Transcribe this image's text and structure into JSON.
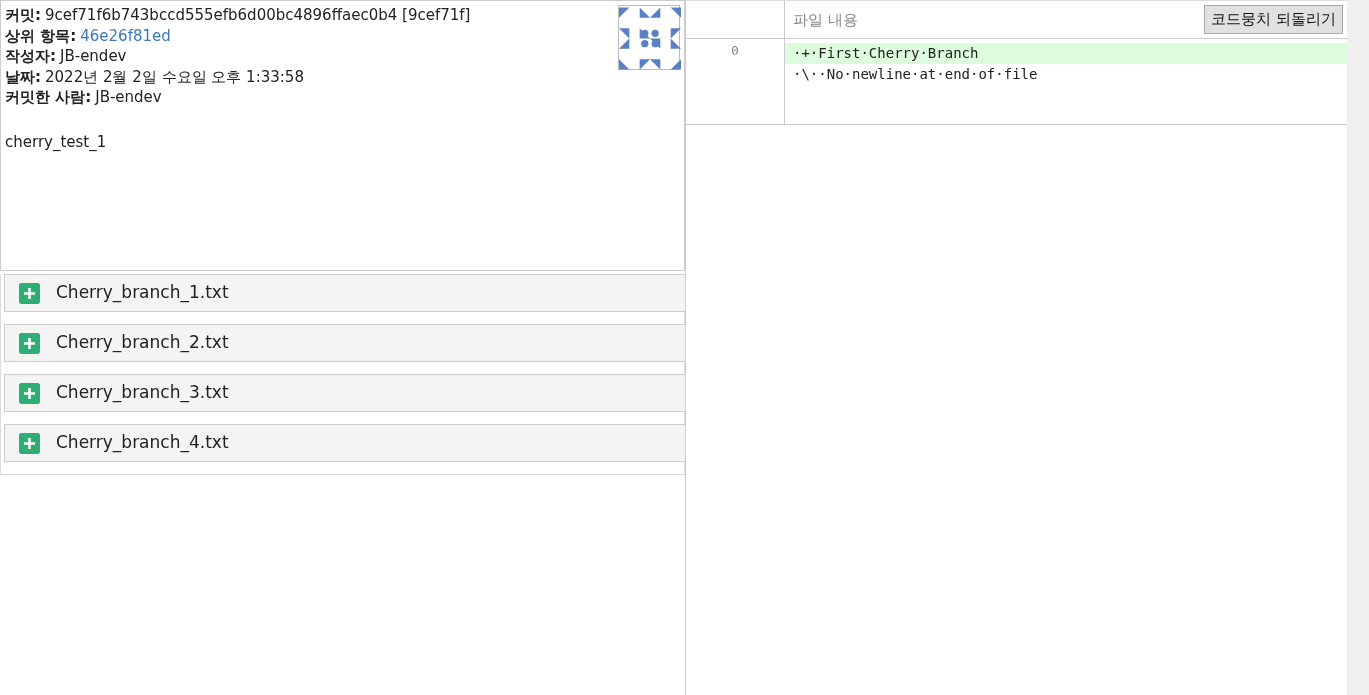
{
  "commit_info": {
    "fields": [
      {
        "label": "커밋:",
        "value": "9cef71f6b743bccd555efb6d00bc4896ffaec0b4 [9cef71f]",
        "kind": "text"
      },
      {
        "label": "상위 항목:",
        "value": "46e26f81ed",
        "kind": "link"
      },
      {
        "label": "작성자:",
        "value": "JB-endev",
        "kind": "text"
      },
      {
        "label": "날짜:",
        "value": "2022년 2월 2일 수요일 오후 1:33:58",
        "kind": "text"
      },
      {
        "label": "커밋한 사람:",
        "value": "JB-endev",
        "kind": "text"
      }
    ],
    "message": "cherry_test_1"
  },
  "files": [
    {
      "name": "Cherry_branch_1.txt",
      "kind": "added"
    },
    {
      "name": "Cherry_branch_2.txt",
      "kind": "added"
    },
    {
      "name": "Cherry_branch_3.txt",
      "kind": "added"
    },
    {
      "name": "Cherry_branch_4.txt",
      "kind": "added"
    }
  ],
  "diff": {
    "header": "파일 내용",
    "revert_button": "코드뭉치 되돌리기",
    "line_number": "0",
    "lines": [
      {
        "text": "·+·First·Cherry·Branch",
        "kind": "added"
      },
      {
        "text": "·\\··No·newline·at·end·of·file",
        "kind": "context"
      }
    ]
  }
}
